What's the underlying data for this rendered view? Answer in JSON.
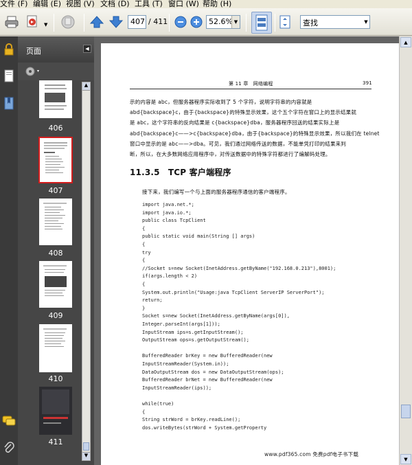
{
  "menu": [
    "文件 (F)",
    "编辑 (E)",
    "视图 (V)",
    "文档 (D)",
    "工具 (T)",
    "窗口 (W)",
    "帮助 (H)"
  ],
  "toolbar": {
    "page_value": "407",
    "page_total": "/ 411",
    "zoom_value": "52.6%",
    "search_placeholder": "查找"
  },
  "panel": {
    "title": "页面"
  },
  "thumbnails": [
    {
      "label": "406"
    },
    {
      "label": "407",
      "selected": true
    },
    {
      "label": "408"
    },
    {
      "label": "409"
    },
    {
      "label": "410"
    },
    {
      "label": "411"
    }
  ],
  "document": {
    "header_chapter": "第 11 章　网络编程",
    "header_page": "391",
    "para1_lines": [
      "示的内容是 abc，但服务器程序实际收到了 5 个字符，说明字符串的内容就是",
      "abd{backspace}c，由于{backspace}的特殊显示效果，这个五个字符在窗口上的显示结果就",
      "是 abc，这个字符串的反向结果是 c{backspace}dba，服务器程序回送的结果实际上是",
      "abd{backspace}c——>c{backspace}dba，由于{backspace}的特殊显示效果，所以我们在 telnet",
      "窗口中显示的是 abc——>dba。可见，我们通过网络传送的数据，不能单凭打印的结果来判",
      "断，所以，在大多数网络应用程序中，对传送数据中的特殊字符都进行了编解码处理。"
    ],
    "section_title": "11.3.5　TCP 客户端程序",
    "intro": "接下来，我们编写一个与上面的服务器程序通信的客户端程序。",
    "code_lines": [
      "import java.net.*;",
      "import java.io.*;",
      "public class TcpClient",
      "{",
      "    public static void main(String [] args)",
      "    {",
      "        try",
      "        {",
      "        //Socket s=new Socket(InetAddress.getByName(\"192.168.0.213\"),8001);",
      "            if(args.length < 2)",
      "            {",
      "            System.out.println(\"Usage:java TcpClient ServerIP ServerPort\");",
      "                return;",
      "            }",
      "            Socket s=new Socket(InetAddress.getByName(args[0]),",
      "                Integer.parseInt(args[1]));",
      "            InputStream ips=s.getInputStream();",
      "            OutputStream ops=s.getOutputStream();",
      "",
      "            BufferedReader brKey = new BufferedReader(new",
      "                                InputStreamReader(System.in));",
      "            DataOutputStream dos = new DataOutputStream(ops);",
      "            BufferedReader brNet = new BufferedReader(new",
      "                                InputStreamReader(ips));",
      "",
      "            while(true)",
      "            {",
      "                String strWord = brKey.readLine();",
      "                dos.writeBytes(strWord + System.getProperty"
    ],
    "watermark": "www.pdf365.com 免费pdf电子书下载"
  }
}
